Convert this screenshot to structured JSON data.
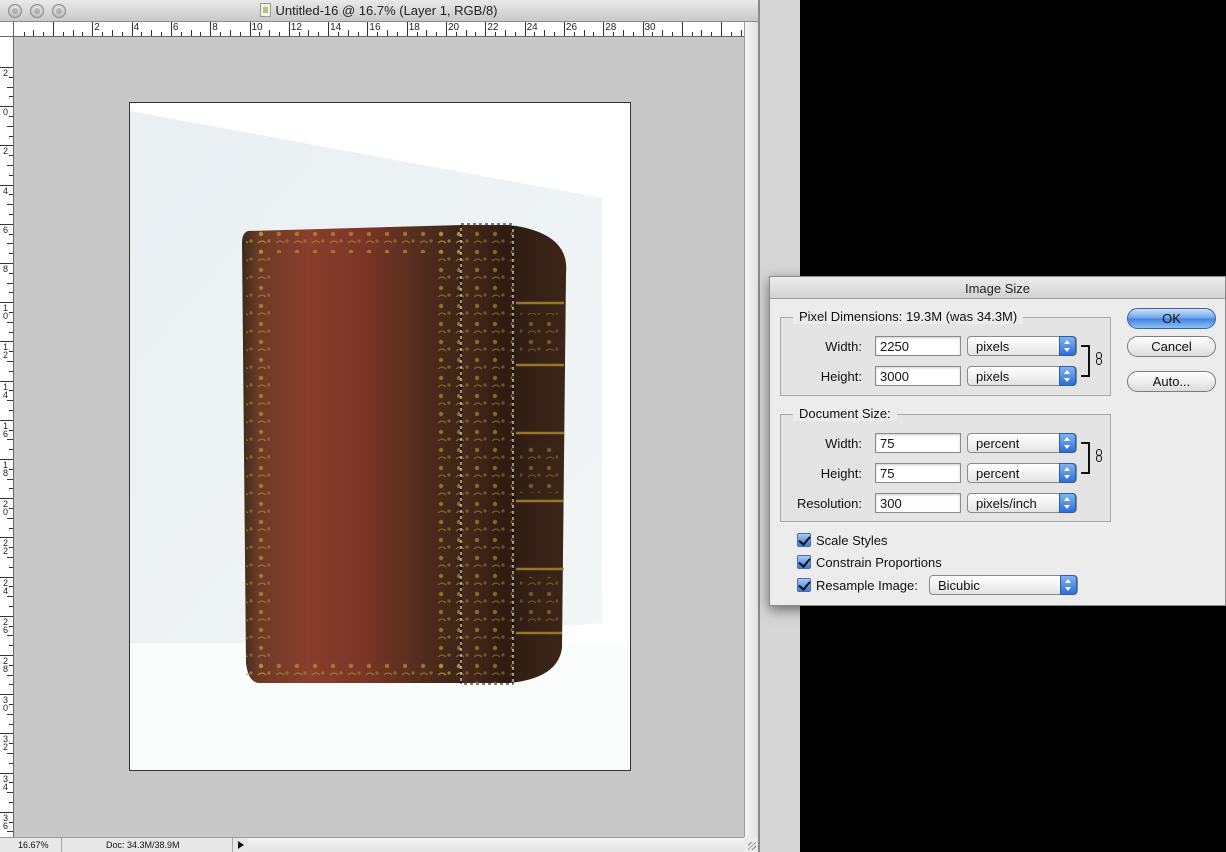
{
  "window": {
    "title": "Untitled-16 @ 16.7% (Layer 1, RGB/8)"
  },
  "rulers": {
    "horizontal": [
      "2",
      "4",
      "6",
      "8",
      "10",
      "12",
      "14",
      "16",
      "18",
      "20",
      "22",
      "24",
      "26",
      "28",
      "30"
    ],
    "vertical": [
      "2",
      "0",
      "2",
      "4",
      "6",
      "8",
      "10",
      "12",
      "14",
      "16",
      "18",
      "20",
      "22",
      "24",
      "26",
      "28",
      "30",
      "32",
      "34",
      "36"
    ]
  },
  "status": {
    "zoom": "16.67%",
    "doc": "Doc: 34.3M/38.9M"
  },
  "dialog": {
    "title": "Image Size",
    "pixel_dimensions": {
      "title": "Pixel Dimensions:",
      "size_info": "19.3M (was 34.3M)",
      "width_label": "Width:",
      "width_value": "2250",
      "width_unit": "pixels",
      "height_label": "Height:",
      "height_value": "3000",
      "height_unit": "pixels"
    },
    "document_size": {
      "title": "Document Size:",
      "width_label": "Width:",
      "width_value": "75",
      "width_unit": "percent",
      "height_label": "Height:",
      "height_value": "75",
      "height_unit": "percent",
      "resolution_label": "Resolution:",
      "resolution_value": "300",
      "resolution_unit": "pixels/inch"
    },
    "options": {
      "scale_styles": "Scale Styles",
      "constrain_proportions": "Constrain Proportions",
      "resample_image": "Resample Image:",
      "resample_method": "Bicubic"
    },
    "buttons": {
      "ok": "OK",
      "cancel": "Cancel",
      "auto": "Auto..."
    }
  }
}
